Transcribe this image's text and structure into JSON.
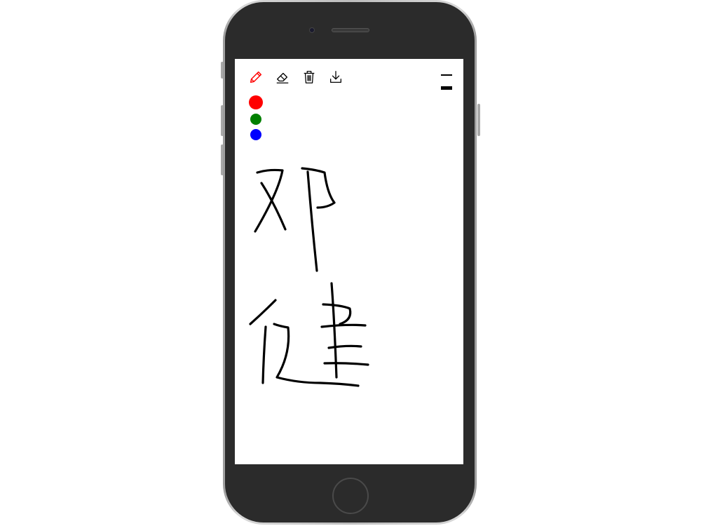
{
  "toolbar": {
    "tools": [
      {
        "name": "pen",
        "icon": "pencil-icon",
        "active": true,
        "color": "#ff0000"
      },
      {
        "name": "eraser",
        "icon": "eraser-icon",
        "active": false,
        "color": "#000000"
      },
      {
        "name": "clear",
        "icon": "trash-icon",
        "active": false,
        "color": "#000000"
      },
      {
        "name": "download",
        "icon": "download-icon",
        "active": false,
        "color": "#000000"
      }
    ]
  },
  "palette": {
    "colors": [
      "#ff0000",
      "#008000",
      "#0000ff"
    ],
    "selected": "#ff0000"
  },
  "stroke_widths": {
    "options": [
      "thin",
      "thick"
    ],
    "selected": "thick"
  },
  "colors": {
    "ink": "#000000",
    "phone_body": "#2b2b2b",
    "active_tool": "#ff0000"
  }
}
